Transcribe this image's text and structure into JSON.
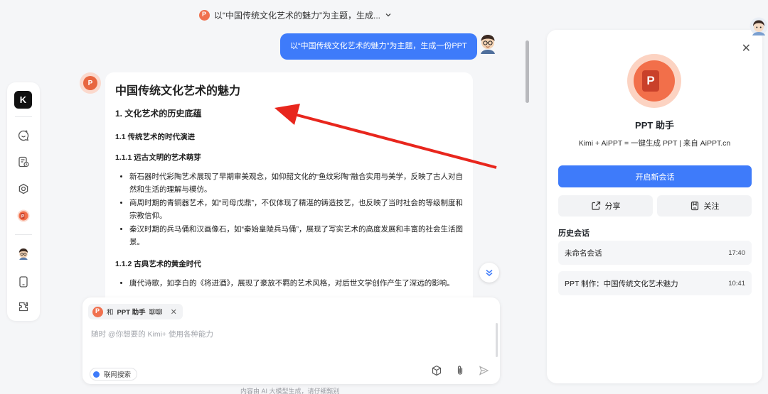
{
  "topbar": {
    "title": "以“中国传统文化艺术的魅力”为主题，生成..."
  },
  "chat": {
    "user_message": "以“中国传统文化艺术的魅力”为主题，生成一份PPT",
    "answer": {
      "title": "中国传统文化艺术的魅力",
      "h2": "1. 文化艺术的历史底蕴",
      "h3": "1.1 传统艺术的时代演进",
      "h4a": "1.1.1 远古文明的艺术萌芽",
      "bullets_a": [
        "新石器时代彩陶艺术展现了早期审美观念，如仰韶文化的“鱼纹彩陶”融合实用与美学，反映了古人对自然和生活的理解与模仿。",
        "商周时期的青铜器艺术，如“司母戊鼎”，不仅体现了精湛的铸造技艺，也反映了当时社会的等级制度和宗教信仰。",
        "秦汉时期的兵马俑和汉画像石，如“秦始皇陵兵马俑”，展现了写实艺术的高度发展和丰富的社会生活图景。"
      ],
      "h4b": "1.1.2 古典艺术的黄金时代",
      "bullets_b": [
        "唐代诗歌，如李白的《将进酒》，展现了豪放不羁的艺术风格，对后世文学创作产生了深远的影响。"
      ]
    }
  },
  "input": {
    "chip_prefix": "和",
    "chip_name": "PPT 助手",
    "chip_suffix": "聊聊",
    "placeholder": "随时 @你想要的 Kimi+ 使用各种能力",
    "web_search_label": "联网搜索",
    "disclaimer": "内容由 AI 大模型生成，请仔细甄别"
  },
  "panel": {
    "title": "PPT 助手",
    "subtitle": "Kimi + AiPPT = 一键生成 PPT | 来自 AiPPT.cn",
    "new_chat_label": "开启新会话",
    "share_label": "分享",
    "follow_label": "关注",
    "history_title": "历史会话",
    "history": [
      {
        "title": "未命名会话",
        "time": "17:40"
      },
      {
        "title": "PPT 制作：中国传统文化艺术魅力",
        "time": "10:41"
      }
    ]
  },
  "colors": {
    "accent": "#3e7bfa",
    "ppt_orange": "#f26f4a",
    "arrow_red": "#e8261d"
  },
  "icons": [
    "kimi-logo-icon",
    "new-chat-icon",
    "history-icon",
    "explore-icon",
    "ppt-assistant-icon",
    "user-avatar-icon",
    "phone-icon",
    "plugin-icon",
    "close-icon",
    "share-icon",
    "bookmark-icon",
    "cube-icon",
    "attachment-icon",
    "send-icon",
    "scroll-down-icon",
    "chevron-down-icon"
  ]
}
